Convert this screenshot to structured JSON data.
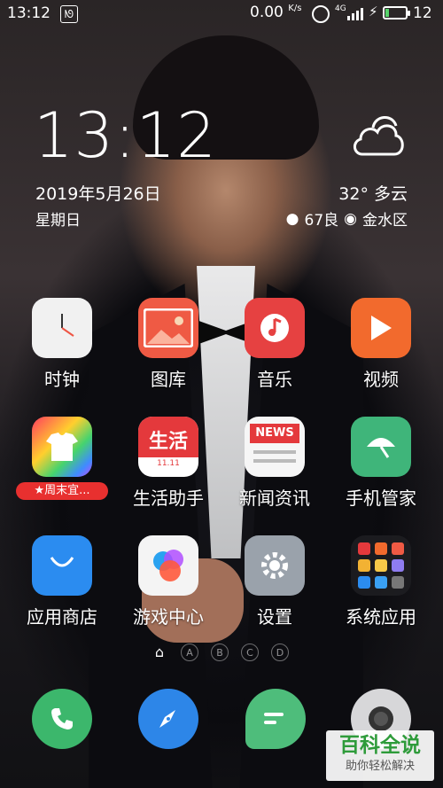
{
  "status_bar": {
    "time": "13:12",
    "net_speed": "0.00",
    "net_unit": "K/s",
    "signal_label": "4G",
    "battery_percent": "12"
  },
  "clock_widget": {
    "time": "13:12",
    "date": "2019年5月26日",
    "weekday": "星期日",
    "weather": "32° 多云",
    "aqi": "67良",
    "location": "金水区"
  },
  "apps": [
    {
      "label": "时钟",
      "icon": "clock-icon"
    },
    {
      "label": "图库",
      "icon": "gallery-icon"
    },
    {
      "label": "音乐",
      "icon": "music-icon"
    },
    {
      "label": "视频",
      "icon": "video-icon"
    },
    {
      "label": "",
      "icon": "store-bag-icon",
      "badge": "★周末宜..."
    },
    {
      "label": "生活助手",
      "icon": "life-assistant-icon",
      "icon_text": "生活",
      "icon_sub": "11.11"
    },
    {
      "label": "新闻资讯",
      "icon": "news-icon",
      "icon_text": "NEWS"
    },
    {
      "label": "手机管家",
      "icon": "umbrella-icon"
    },
    {
      "label": "应用商店",
      "icon": "app-store-icon"
    },
    {
      "label": "游戏中心",
      "icon": "game-center-icon"
    },
    {
      "label": "设置",
      "icon": "settings-gear-icon"
    },
    {
      "label": "系统应用",
      "icon": "system-folder-icon"
    }
  ],
  "page_indicator": [
    "A",
    "B",
    "C",
    "D"
  ],
  "dock": [
    "phone-icon",
    "browser-compass-icon",
    "messages-icon",
    "camera-icon"
  ],
  "watermark": {
    "title": "百科全说",
    "subtitle": "助你轻松解决"
  }
}
